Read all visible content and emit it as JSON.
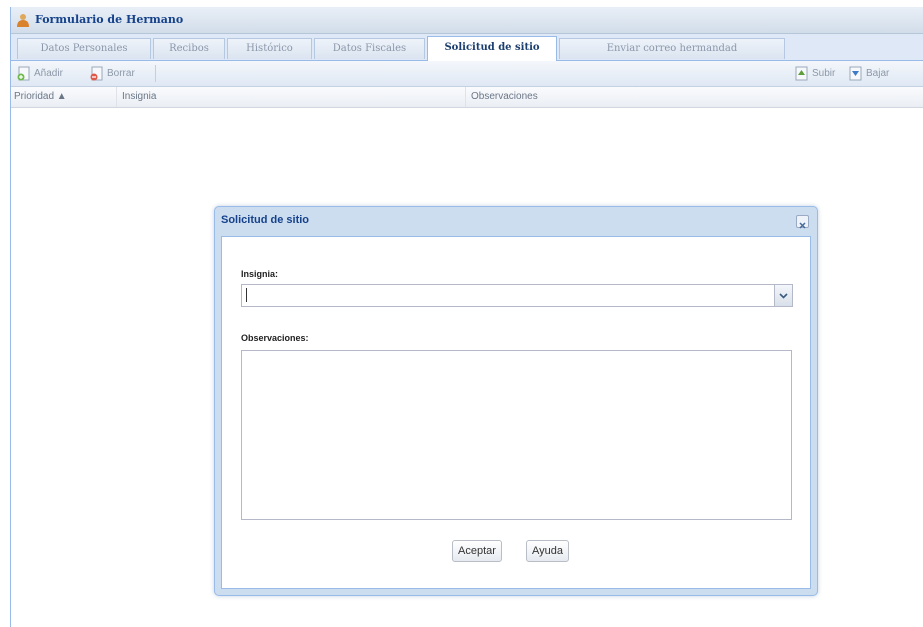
{
  "window": {
    "title": "Formulario de Hermano",
    "icon": "user-icon"
  },
  "tabs": [
    {
      "label": "Datos Personales",
      "active": false
    },
    {
      "label": "Recibos",
      "active": false
    },
    {
      "label": "Histórico",
      "active": false
    },
    {
      "label": "Datos Fiscales",
      "active": false
    },
    {
      "label": "Solicitud de sitio",
      "active": true
    },
    {
      "label": "Enviar correo hermandad",
      "active": false
    }
  ],
  "toolbar": {
    "add_label": "Añadir",
    "delete_label": "Borrar",
    "up_label": "Subir",
    "down_label": "Bajar"
  },
  "grid": {
    "columns": [
      "Prioridad ▲",
      "Insignia",
      "Observaciones"
    ]
  },
  "dialog": {
    "title": "Solicitud de sitio",
    "insignia_label": "Insignia:",
    "insignia_value": "",
    "observaciones_label": "Observaciones:",
    "observaciones_value": "",
    "accept_label": "Aceptar",
    "help_label": "Ayuda"
  },
  "colors": {
    "title": "#15428b",
    "panel_border": "#99bbe8",
    "dialog_frame": "#cdddf0"
  }
}
